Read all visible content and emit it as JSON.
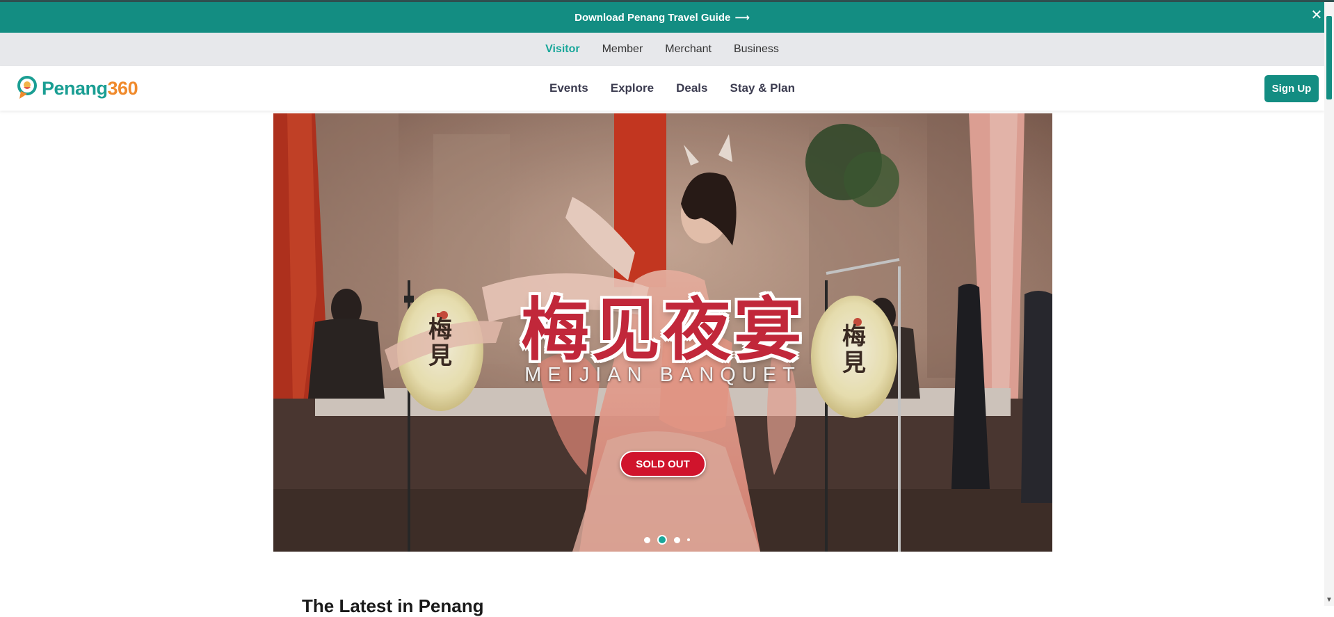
{
  "announcement": {
    "text": "Download Penang Travel Guide",
    "arrow": "⟶",
    "close": "✕"
  },
  "audience_tabs": [
    {
      "label": "Visitor",
      "active": true
    },
    {
      "label": "Member",
      "active": false
    },
    {
      "label": "Merchant",
      "active": false
    },
    {
      "label": "Business",
      "active": false
    }
  ],
  "header": {
    "logo_part1": "Penang",
    "logo_part2": "360",
    "nav": [
      "Events",
      "Explore",
      "Deals",
      "Stay & Plan"
    ],
    "signup_label": "Sign Up"
  },
  "hero": {
    "title": "梅见夜宴",
    "subtitle": "MEIJIAN BANQUET",
    "lantern_text": "梅見",
    "badge": "SOLD OUT",
    "carousel_dots": 4,
    "active_dot": 1
  },
  "sections": {
    "latest_title": "The Latest in Penang"
  },
  "colors": {
    "brand_teal": "#138d82",
    "accent_teal": "#19a79a",
    "logo_orange": "#f08a2c",
    "soldout_red": "#d0142c"
  }
}
